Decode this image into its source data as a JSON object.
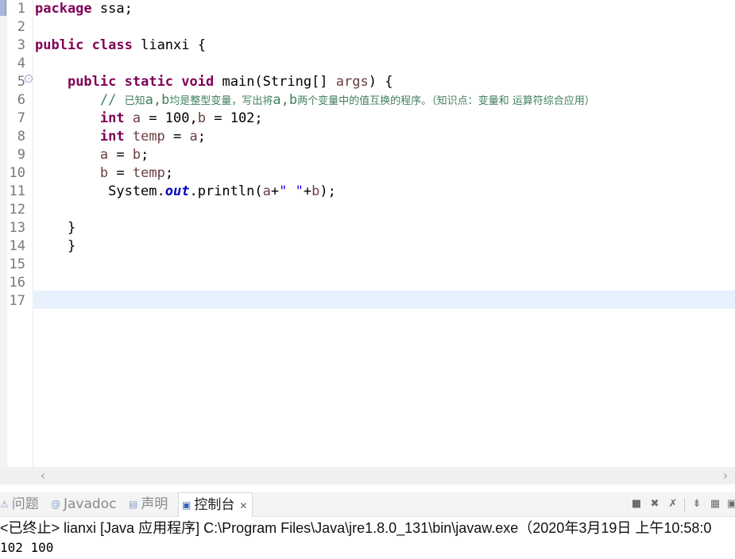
{
  "editor": {
    "line_numbers": [
      "1",
      "2",
      "3",
      "4",
      "5",
      "6",
      "7",
      "8",
      "9",
      "10",
      "11",
      "12",
      "13",
      "14",
      "15",
      "16",
      "17"
    ],
    "lines": {
      "l1_kw": "package",
      "l1_rest": " ssa;",
      "l3_kw1": "public",
      "l3_kw2": "class",
      "l3_rest": " lianxi {",
      "l5_indent": "    ",
      "l5_kw1": "public",
      "l5_kw2": "static",
      "l5_kw3": "void",
      "l5_mid": " main(String[] ",
      "l5_var": "args",
      "l5_end": ") {",
      "l6_indent": "        ",
      "l6_slash": "// ",
      "l6_c1": "已知",
      "l6_c2": "a,b",
      "l6_c3": "均是整型变量，写出将",
      "l6_c4": "a,b",
      "l6_c5": "两个变量中的值互换的程序。（知识点：变量和 运算符综合应用）",
      "l7_indent": "        ",
      "l7_kw": "int",
      "l7_a": " a",
      "l7_mid": " = 100,",
      "l7_b": "b",
      "l7_end": " = 102;",
      "l8_indent": "        ",
      "l8_kw": "int",
      "l8_temp": " temp",
      "l8_mid": " = ",
      "l8_a": "a",
      "l8_end": ";",
      "l9_indent": "        ",
      "l9_a": "a",
      "l9_mid": " = ",
      "l9_b": "b",
      "l9_end": ";",
      "l10_indent": "        ",
      "l10_b": "b",
      "l10_mid": " = ",
      "l10_temp": "temp",
      "l10_end": ";",
      "l11_indent": "         System.",
      "l11_out": "out",
      "l11_mid": ".println(",
      "l11_a": "a",
      "l11_plus": "+",
      "l11_str": "\" \"",
      "l11_plus2": "+",
      "l11_b": "b",
      "l11_end": ");",
      "l13": "    }",
      "l14": "    }"
    },
    "scroll_left_glyph": "‹",
    "scroll_right_glyph": "›"
  },
  "console_view": {
    "tabs": [
      {
        "label": "问题",
        "icon": "problems-icon",
        "glyph": "⚠"
      },
      {
        "label": "Javadoc",
        "icon": "javadoc-icon",
        "glyph": "@"
      },
      {
        "label": "声明",
        "icon": "declaration-icon",
        "glyph": "▤"
      },
      {
        "label": "控制台",
        "icon": "console-icon",
        "glyph": "▣",
        "active": true
      }
    ],
    "close_glyph": "✕",
    "toolbar": [
      {
        "icon": "terminate-icon",
        "glyph": "■"
      },
      {
        "icon": "remove-launch-icon",
        "glyph": "✖"
      },
      {
        "icon": "remove-all-terminated-icon",
        "glyph": "✗"
      },
      {
        "icon": "scroll-lock-icon",
        "glyph": "⇟"
      },
      {
        "icon": "word-wrap-icon",
        "glyph": "▦"
      },
      {
        "icon": "show-console-icon",
        "glyph": "▣"
      }
    ],
    "status": "<已终止> lianxi [Java 应用程序] C:\\Program Files\\Java\\jre1.8.0_131\\bin\\javaw.exe（2020年3月19日 上午10:58:0",
    "output": "102 100"
  }
}
